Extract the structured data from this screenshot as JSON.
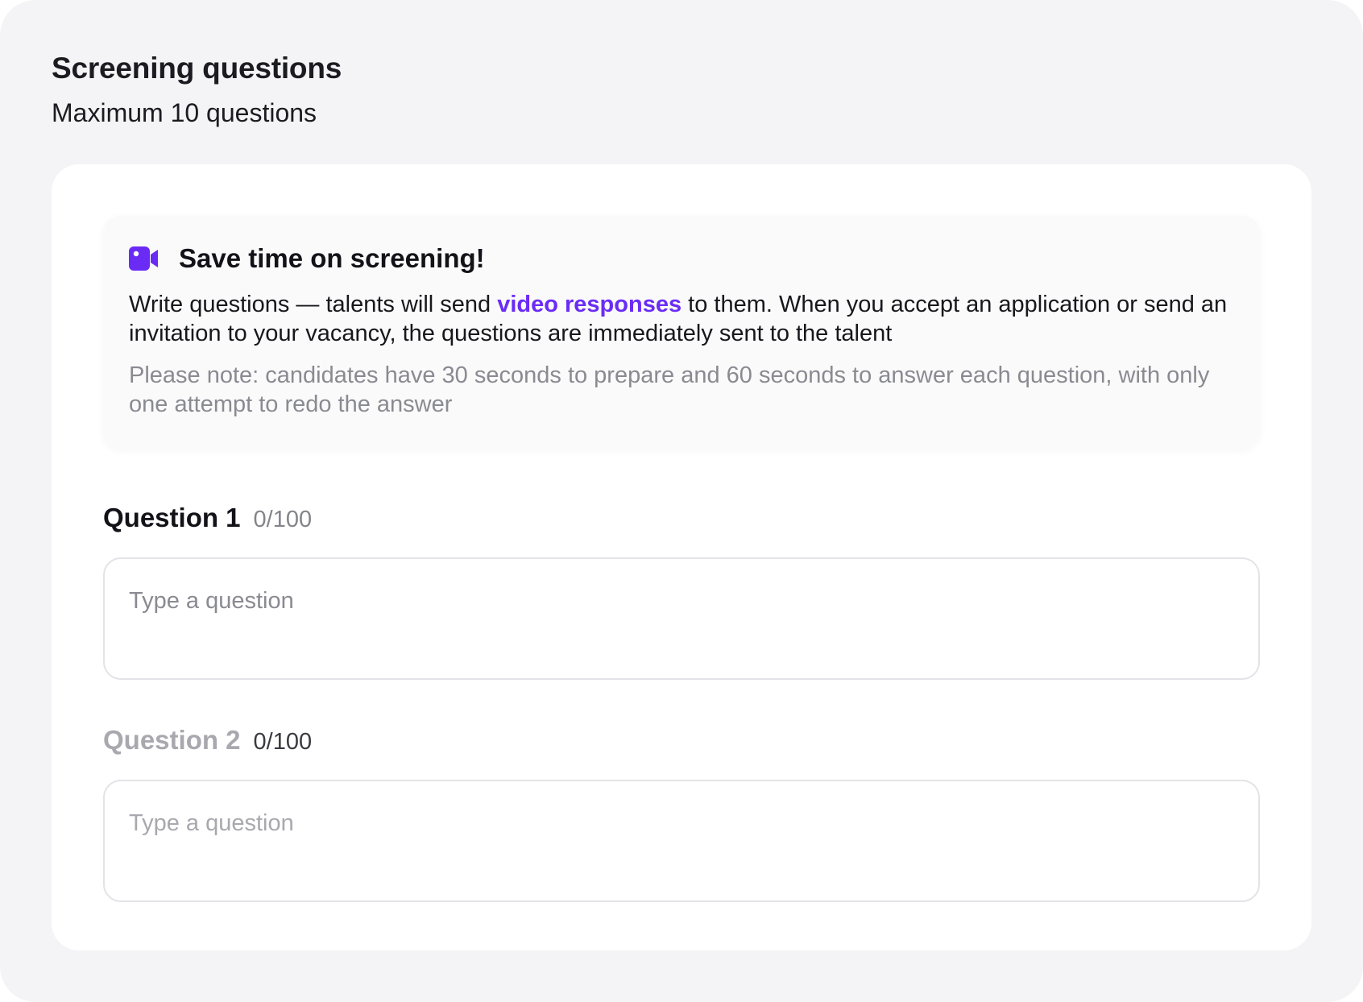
{
  "header": {
    "title": "Screening questions",
    "subtitle": "Maximum 10 questions"
  },
  "callout": {
    "icon": "video-camera-icon",
    "title": "Save time on screening!",
    "body_before": "Write questions — talents will send ",
    "body_link": "video responses",
    "body_after": " to them. When you accept an application or send an invitation to your vacancy, the questions are immediately sent to the talent",
    "note": "Please note: candidates have 30 seconds to prepare and 60 seconds to answer each question, with only one attempt to redo the answer"
  },
  "questions": [
    {
      "label": "Question 1",
      "counter": "0/100",
      "value": "",
      "placeholder": "Type a question",
      "state": "active"
    },
    {
      "label": "Question 2",
      "counter": "0/100",
      "value": "",
      "placeholder": "Type a question",
      "state": "disabled"
    }
  ],
  "colors": {
    "accent": "#6a2cf5",
    "background": "#f4f4f6",
    "card": "#ffffff",
    "muted_text": "#8a8a92",
    "disabled_text": "#a8a8ae"
  }
}
